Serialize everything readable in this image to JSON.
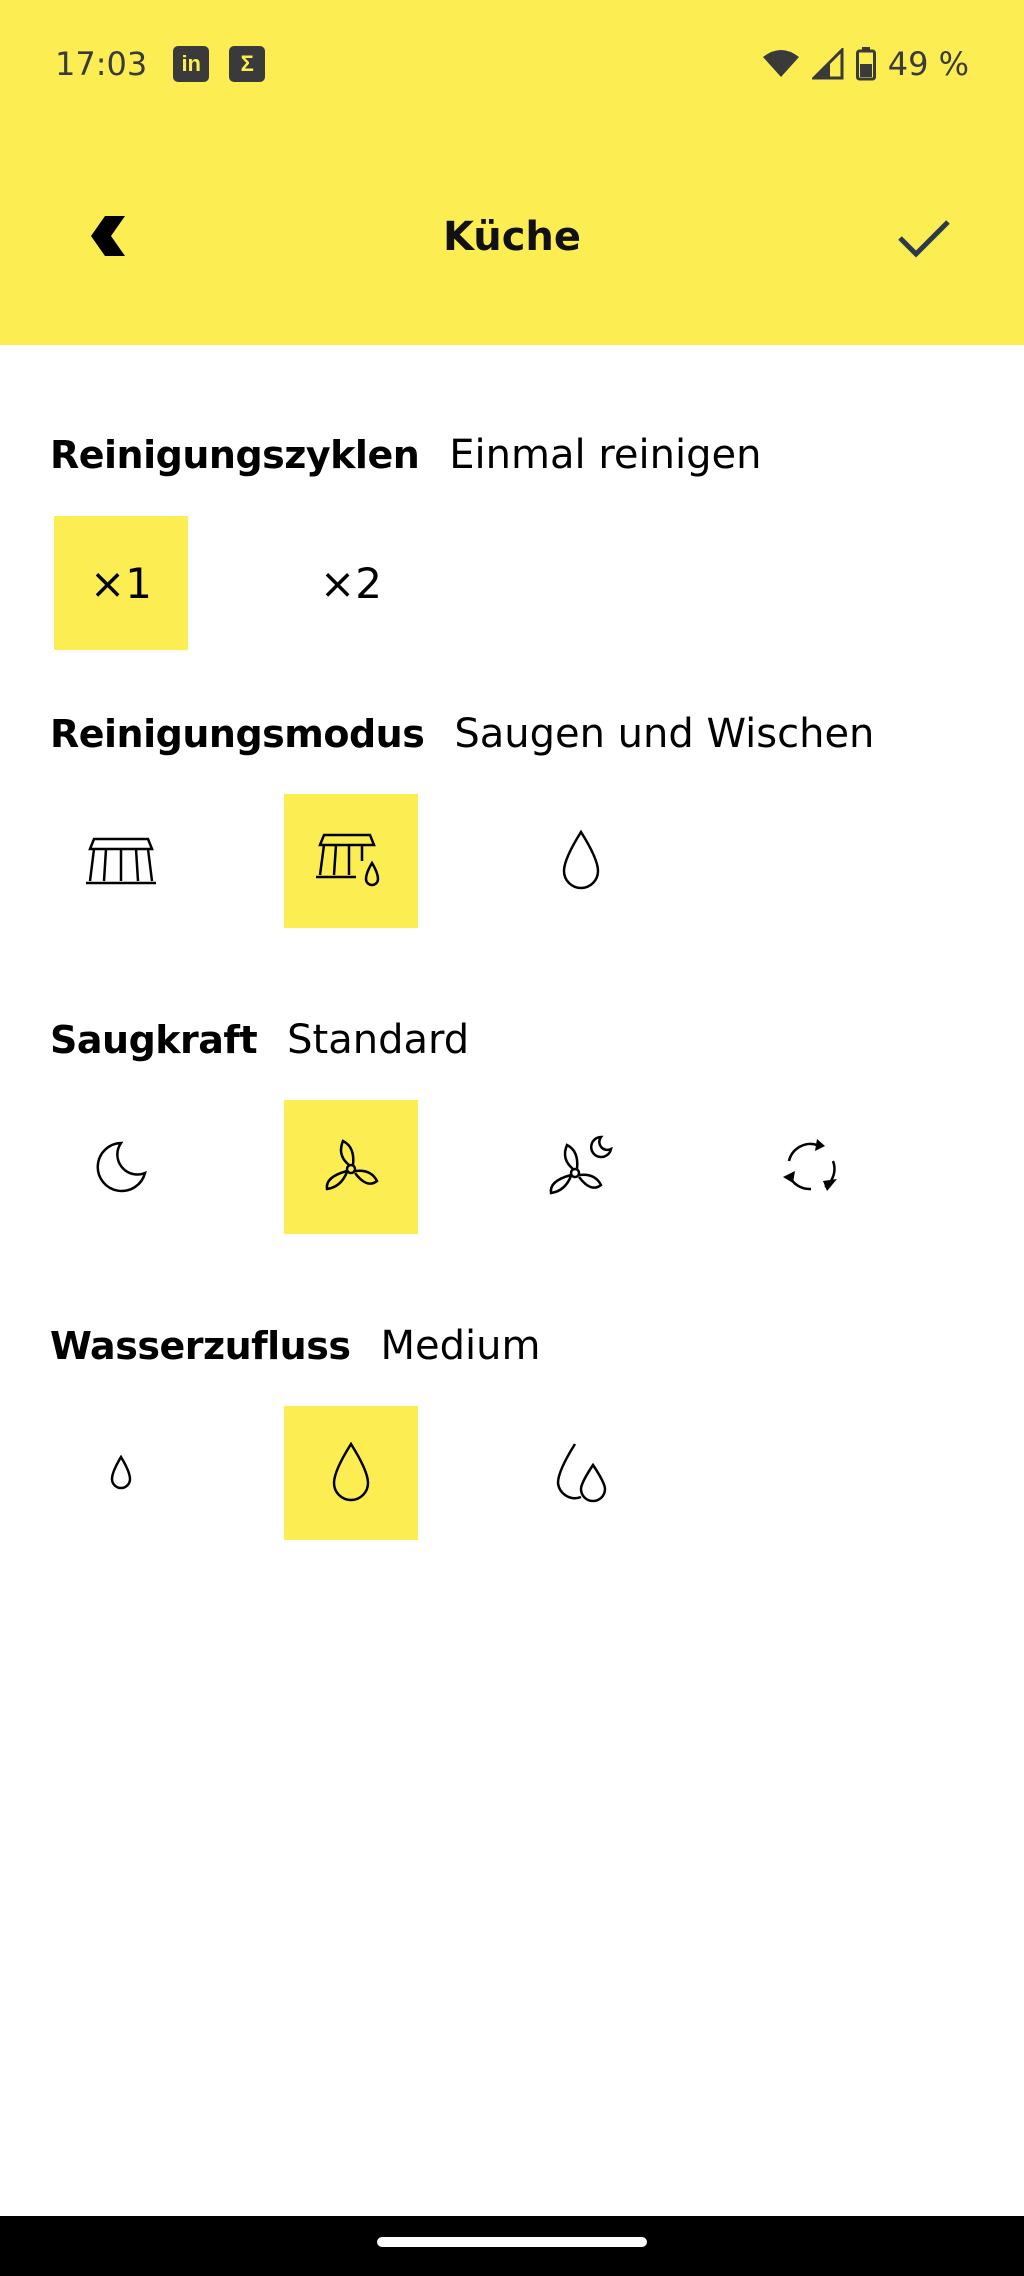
{
  "status_bar": {
    "time": "17:03",
    "app_icons": [
      "linkedin-icon",
      "sigma-icon"
    ],
    "battery_text": "49 %"
  },
  "header": {
    "title": "Küche",
    "back_icon": "chevron-left-icon",
    "confirm_icon": "checkmark-icon",
    "background": "#fcee52"
  },
  "sections": {
    "cycles": {
      "label": "Reinigungszyklen",
      "value": "Einmal reinigen",
      "options": [
        {
          "label": "×1",
          "selected": true
        },
        {
          "label": "×2",
          "selected": false
        }
      ]
    },
    "mode": {
      "label": "Reinigungsmodus",
      "value": "Saugen und Wischen",
      "options": [
        {
          "icon": "brush-icon",
          "selected": false
        },
        {
          "icon": "brush-drop-icon",
          "selected": true
        },
        {
          "icon": "drop-icon",
          "selected": false
        }
      ]
    },
    "suction": {
      "label": "Saugkraft",
      "value": "Standard",
      "options": [
        {
          "icon": "moon-icon",
          "selected": false
        },
        {
          "icon": "fan-icon",
          "selected": true
        },
        {
          "icon": "fan-moon-icon",
          "selected": false
        },
        {
          "icon": "auto-cycle-icon",
          "selected": false
        }
      ]
    },
    "water": {
      "label": "Wasserzufluss",
      "value": "Medium",
      "options": [
        {
          "icon": "small-drop-icon",
          "selected": false
        },
        {
          "icon": "medium-drop-icon",
          "selected": true
        },
        {
          "icon": "double-drop-icon",
          "selected": false
        }
      ]
    }
  },
  "accent_color": "#fcee52"
}
